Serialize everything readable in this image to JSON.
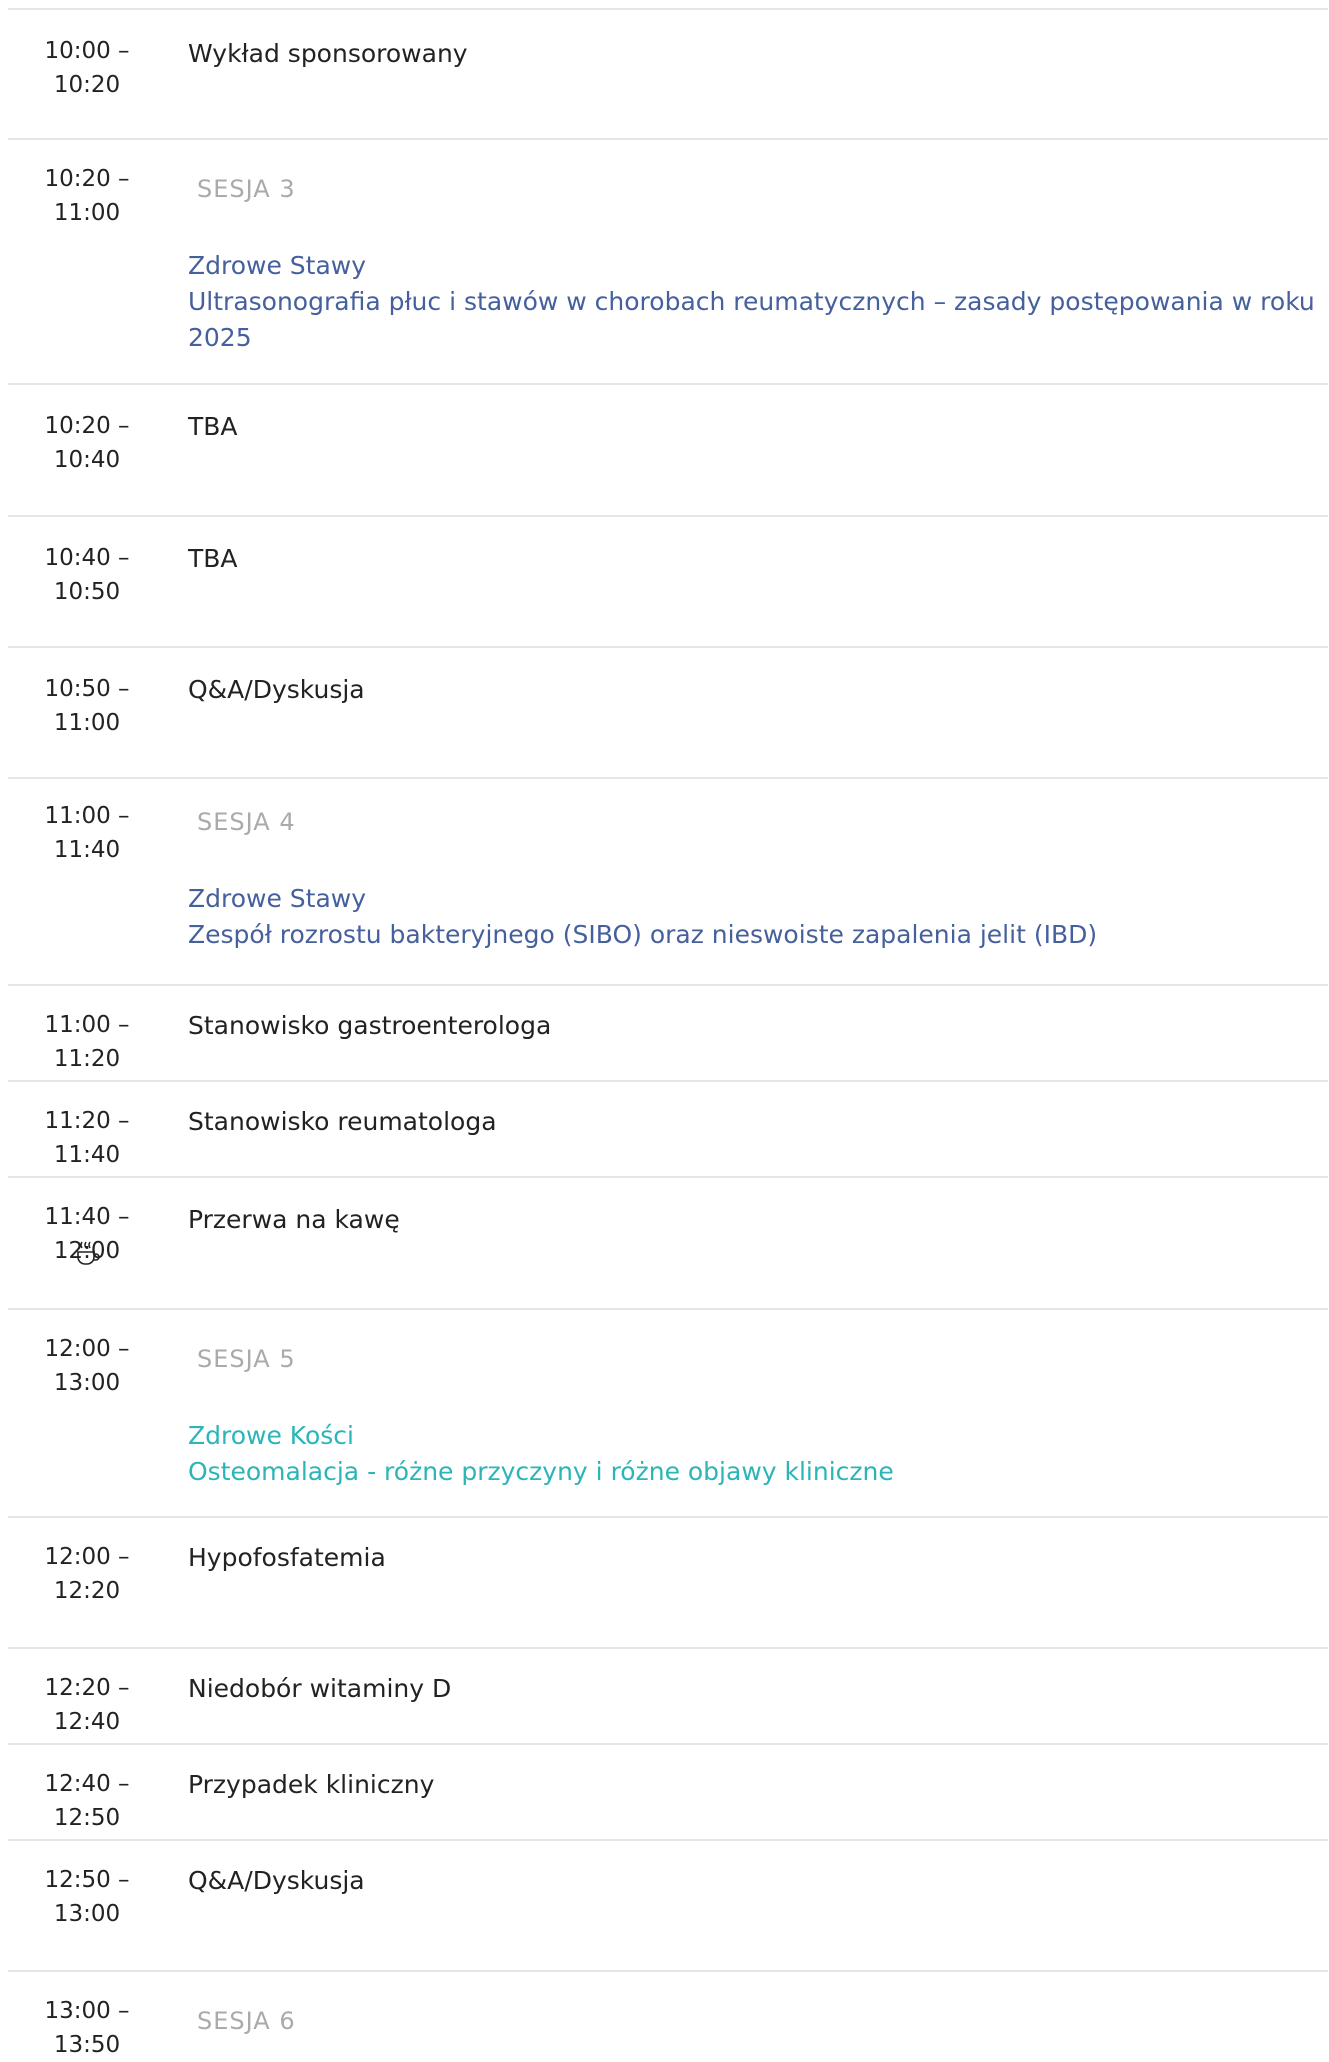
{
  "colors": {
    "divider": "#e6e6e6",
    "text": "#222222",
    "session_label": "#aaaaaa",
    "topic_blue": "#46609d",
    "topic_teal": "#2bb5b8"
  },
  "agenda": [
    {
      "time_line1": "10:00 –",
      "time_line2": "10:20",
      "title": "Wykład sponsorowany"
    },
    {
      "time_line1": "10:20 –",
      "time_line2": "11:00",
      "session": "SESJA 3",
      "topic_line1": "Zdrowe Stawy",
      "topic_line2": "Ultrasonografia płuc i stawów w chorobach reumatycznych – zasady postępowania w roku 2025"
    },
    {
      "time_line1": "10:20 –",
      "time_line2": "10:40",
      "title": "TBA"
    },
    {
      "time_line1": "10:40 –",
      "time_line2": "10:50",
      "title": "TBA"
    },
    {
      "time_line1": "10:50 –",
      "time_line2": "11:00",
      "title": "Q&A/Dyskusja"
    },
    {
      "time_line1": "11:00 – 11:40",
      "session": "SESJA 4",
      "topic_line1": "Zdrowe Stawy",
      "topic_line2": "Zespół rozrostu bakteryjnego (SIBO) oraz nieswoiste zapalenia jelit (IBD)"
    },
    {
      "time_line1": "11:00 – 11:20",
      "title": "Stanowisko gastroenterologa"
    },
    {
      "time_line1": "11:20 – 11:40",
      "title": "Stanowisko reumatologa"
    },
    {
      "time_line1": "11:40 – 12:00",
      "title": "Przerwa na kawę",
      "icon": "coffee-icon"
    },
    {
      "time_line1": "12:00 –",
      "time_line2": "13:00",
      "session": "SESJA 5",
      "topic_line1": "Zdrowe Kości",
      "topic_line2": "Osteomalacja - różne przyczyny i różne objawy kliniczne"
    },
    {
      "time_line1": "12:00 –",
      "time_line2": "12:20",
      "title": "Hypofosfatemia"
    },
    {
      "time_line1": "12:20 – 12:40",
      "title": "Niedobór witaminy D"
    },
    {
      "time_line1": "12:40 – 12:50",
      "title": "Przypadek kliniczny"
    },
    {
      "time_line1": "12:50 –",
      "time_line2": "13:00",
      "title": "Q&A/Dyskusja"
    },
    {
      "time_line1": "13:00 –",
      "time_line2": "13:50",
      "session": "SESJA 6"
    }
  ]
}
